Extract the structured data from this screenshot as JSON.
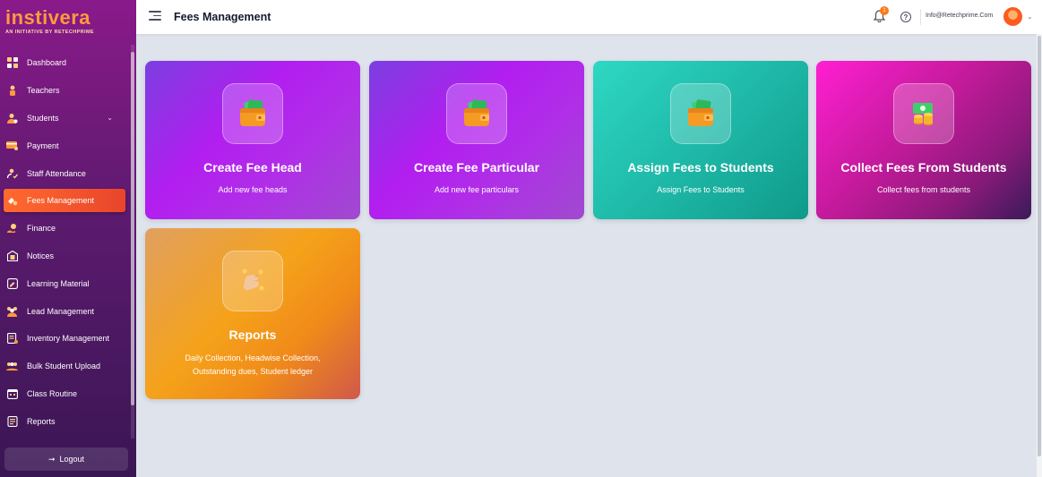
{
  "brand": {
    "name": "instivera",
    "tagline": "AN INITIATIVE BY RETECHPRIME"
  },
  "sidebar": {
    "items": [
      {
        "label": "Dashboard",
        "icon": "dashboard-icon"
      },
      {
        "label": "Teachers",
        "icon": "teacher-icon"
      },
      {
        "label": "Students",
        "icon": "students-icon",
        "expandable": true
      },
      {
        "label": "Payment",
        "icon": "payment-icon"
      },
      {
        "label": "Staff Attendance",
        "icon": "attendance-icon"
      },
      {
        "label": "Fees Management",
        "icon": "fees-icon",
        "active": true
      },
      {
        "label": "Finance",
        "icon": "finance-icon"
      },
      {
        "label": "Notices",
        "icon": "notices-icon"
      },
      {
        "label": "Learning Material",
        "icon": "learning-icon"
      },
      {
        "label": "Lead Management",
        "icon": "lead-icon"
      },
      {
        "label": "Inventory Management",
        "icon": "inventory-icon"
      },
      {
        "label": "Bulk Student Upload",
        "icon": "upload-icon"
      },
      {
        "label": "Class Routine",
        "icon": "calendar-icon"
      },
      {
        "label": "Reports",
        "icon": "reports-icon"
      }
    ],
    "logout_label": "Logout"
  },
  "header": {
    "title": "Fees Management",
    "notification_count": "1",
    "email": "Info@Retechprime.Com"
  },
  "cards": {
    "fee_head": {
      "title": "Create Fee Head",
      "subtitle": "Add new fee heads"
    },
    "fee_particular": {
      "title": "Create Fee Particular",
      "subtitle": "Add new fee particulars"
    },
    "assign": {
      "title": "Assign Fees to Students",
      "subtitle": "Assign Fees to Students"
    },
    "collect": {
      "title": "Collect Fees From Students",
      "subtitle": "Collect fees from students"
    },
    "reports": {
      "title": "Reports",
      "subtitle": "Daily Collection, Headwise Collection, Outstanding dues, Student ledger"
    }
  },
  "colors": {
    "accent": "#ff6a2f",
    "sidebar_top": "#8a1a8a",
    "sidebar_bottom": "#3a1654",
    "brand_orange": "#ff9a3c"
  }
}
